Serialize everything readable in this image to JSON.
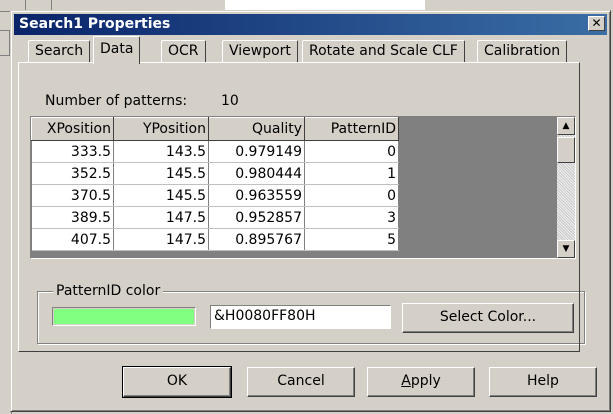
{
  "window": {
    "title": "Search1 Properties",
    "close_glyph": "✕"
  },
  "tabs": [
    {
      "label": "Search",
      "active": false
    },
    {
      "label": "Data",
      "active": true
    },
    {
      "label": "OCR",
      "active": false
    },
    {
      "label": "Viewport",
      "active": false
    },
    {
      "label": "Rotate and Scale CLF",
      "active": false
    },
    {
      "label": "Calibration",
      "active": false
    }
  ],
  "data_tab": {
    "num_patterns_label": "Number of patterns:",
    "num_patterns_value": "10",
    "table": {
      "columns": [
        "XPosition",
        "YPosition",
        "Quality",
        "PatternID"
      ],
      "rows": [
        [
          "333.5",
          "143.5",
          "0.979149",
          "0"
        ],
        [
          "352.5",
          "145.5",
          "0.980444",
          "1"
        ],
        [
          "370.5",
          "145.5",
          "0.963559",
          "0"
        ],
        [
          "389.5",
          "147.5",
          "0.952857",
          "3"
        ],
        [
          "407.5",
          "147.5",
          "0.895767",
          "5"
        ]
      ]
    },
    "color_group": {
      "legend": "PatternID color",
      "swatch_color": "#80ff80",
      "value": "&H0080FF80H",
      "select_button": "Select Color..."
    }
  },
  "buttons": {
    "ok": "OK",
    "cancel": "Cancel",
    "apply_first": "A",
    "apply_rest": "pply",
    "help": "Help"
  },
  "icons": {
    "scroll_up": "▲",
    "scroll_down": "▼"
  }
}
